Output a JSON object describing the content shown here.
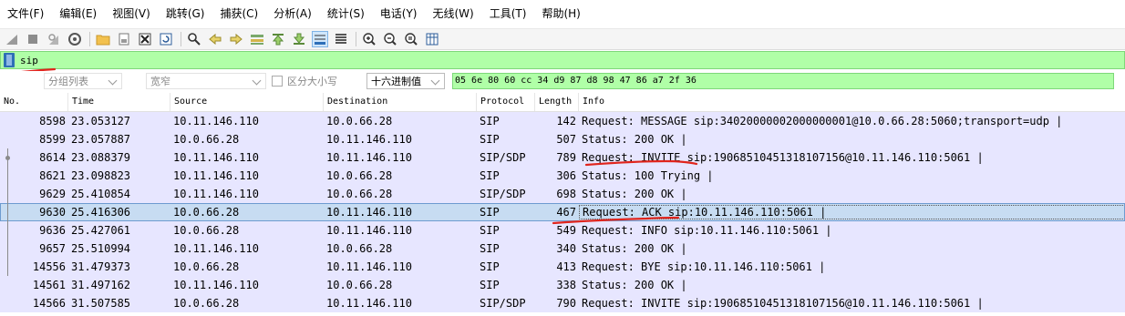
{
  "menu": [
    "文件(F)",
    "编辑(E)",
    "视图(V)",
    "跳转(G)",
    "捕获(C)",
    "分析(A)",
    "统计(S)",
    "电话(Y)",
    "无线(W)",
    "工具(T)",
    "帮助(H)"
  ],
  "toolbar": {
    "icons": [
      "shark-fin-start-icon",
      "stop-capture-icon",
      "restart-capture-icon",
      "capture-options-icon",
      "open-file-icon",
      "file-set-icon",
      "close-file-icon",
      "reload-icon",
      "find-packet-icon",
      "go-back-icon",
      "go-forward-icon",
      "go-to-packet-icon",
      "first-packet-icon",
      "last-packet-icon",
      "auto-scroll-icon",
      "colorize-icon",
      "zoom-in-icon",
      "zoom-out-icon",
      "normal-size-icon",
      "resize-columns-icon"
    ]
  },
  "filter": {
    "value": "sip"
  },
  "search_options": {
    "scope": "分组列表",
    "char_width": "宽窄",
    "case_label": "区分大小写",
    "mode": "十六进制值",
    "hex_value": "05 6e 80 60 cc 34 d9 87 d8 98 47 86 a7 2f 36"
  },
  "packet_list": {
    "columns": [
      "No.",
      "Time",
      "Source",
      "Destination",
      "Protocol",
      "Length",
      "Info"
    ],
    "rows": [
      {
        "no": "8598",
        "time": "23.053127",
        "src": "10.11.146.110",
        "dst": "10.0.66.28",
        "proto": "SIP",
        "len": "142",
        "info": "Request: MESSAGE sip:34020000002000000001@10.0.66.28:5060;transport=udp |"
      },
      {
        "no": "8599",
        "time": "23.057887",
        "src": "10.0.66.28",
        "dst": "10.11.146.110",
        "proto": "SIP",
        "len": "507",
        "info": "Status: 200 OK |"
      },
      {
        "no": "8614",
        "time": "23.088379",
        "src": "10.11.146.110",
        "dst": "10.11.146.110",
        "proto": "SIP/SDP",
        "len": "789",
        "info": "Request: INVITE sip:19068510451318107156@10.11.146.110:5061 |"
      },
      {
        "no": "8621",
        "time": "23.098823",
        "src": "10.11.146.110",
        "dst": "10.0.66.28",
        "proto": "SIP",
        "len": "306",
        "info": "Status: 100 Trying |"
      },
      {
        "no": "9629",
        "time": "25.410854",
        "src": "10.11.146.110",
        "dst": "10.0.66.28",
        "proto": "SIP/SDP",
        "len": "698",
        "info": "Status: 200 OK |"
      },
      {
        "no": "9630",
        "time": "25.416306",
        "src": "10.0.66.28",
        "dst": "10.11.146.110",
        "proto": "SIP",
        "len": "467",
        "info": "Request: ACK sip:10.11.146.110:5061 |"
      },
      {
        "no": "9636",
        "time": "25.427061",
        "src": "10.0.66.28",
        "dst": "10.11.146.110",
        "proto": "SIP",
        "len": "549",
        "info": "Request: INFO sip:10.11.146.110:5061 |"
      },
      {
        "no": "9657",
        "time": "25.510994",
        "src": "10.11.146.110",
        "dst": "10.0.66.28",
        "proto": "SIP",
        "len": "340",
        "info": "Status: 200 OK |"
      },
      {
        "no": "14556",
        "time": "31.479373",
        "src": "10.0.66.28",
        "dst": "10.11.146.110",
        "proto": "SIP",
        "len": "413",
        "info": "Request: BYE sip:10.11.146.110:5061 |"
      },
      {
        "no": "14561",
        "time": "31.497162",
        "src": "10.11.146.110",
        "dst": "10.0.66.28",
        "proto": "SIP",
        "len": "338",
        "info": "Status: 200 OK |"
      },
      {
        "no": "14566",
        "time": "31.507585",
        "src": "10.0.66.28",
        "dst": "10.11.146.110",
        "proto": "SIP/SDP",
        "len": "790",
        "info": "Request: INVITE sip:19068510451318107156@10.11.146.110:5061 |"
      }
    ]
  },
  "colors": {
    "row_bg": "#e7e6ff",
    "selected_bg": "#c7dcf2",
    "filter_bg": "#b0ffa7",
    "annotation_red": "#e0251d"
  }
}
